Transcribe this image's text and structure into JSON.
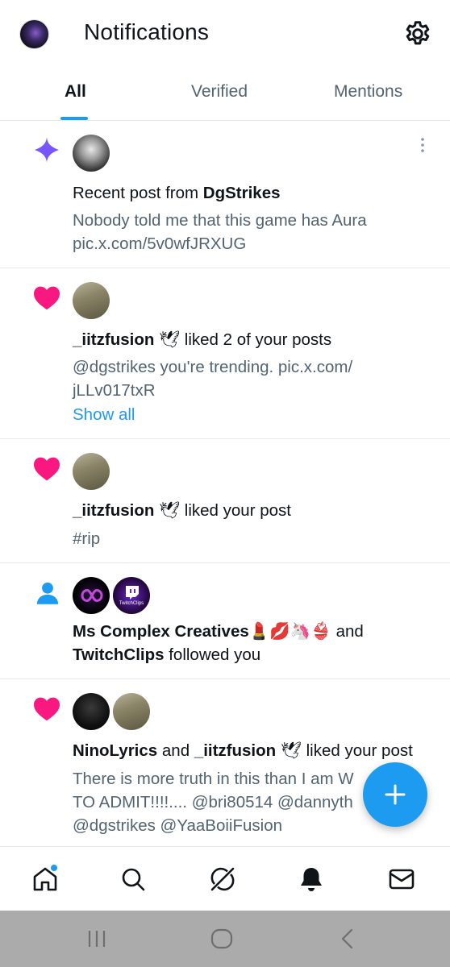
{
  "header": {
    "title": "Notifications"
  },
  "tabs": [
    {
      "label": "All",
      "active": true
    },
    {
      "label": "Verified",
      "active": false
    },
    {
      "label": "Mentions",
      "active": false
    }
  ],
  "notifications": [
    {
      "type": "recent-post",
      "icon": "sparkle-icon",
      "prefix": "Recent post from ",
      "user": "DgStrikes",
      "body_line1": "Nobody told me that this game has Aura",
      "body_line2": "pic.x.com/5v0wfJRXUG"
    },
    {
      "type": "like",
      "icon": "heart-icon",
      "user": "_iitzfusion",
      "action": "liked 2 of your posts",
      "body_line1": "@dgstrikes you're trending. pic.x.com/",
      "body_line2": "jLLv017txR",
      "show_all": "Show all"
    },
    {
      "type": "like",
      "icon": "heart-icon",
      "user": "_iitzfusion",
      "action": "liked your post",
      "body_line1": "#rip"
    },
    {
      "type": "follow",
      "icon": "person-icon",
      "user1": "Ms Complex Creatives",
      "user1_emoji": "💄💋🦄👙",
      "joiner": "and",
      "user2": "TwitchClips",
      "action": "followed you",
      "badge_text": "TwitchClips"
    },
    {
      "type": "like",
      "icon": "heart-icon",
      "user1": "NinoLyrics",
      "joiner": "and",
      "user2": "_iitzfusion",
      "action": "liked your post",
      "body_line1": "There is more truth in this than I am W",
      "body_line2": "TO ADMIT!!!!.... @bri80514 @dannyth",
      "body_line3": "@dgstrikes @YaaBoiiFusion"
    }
  ],
  "colors": {
    "accent": "#1d9bf0",
    "like": "#f91880",
    "sparkle": "#7856ff",
    "secondary_text": "#536471"
  },
  "bottom_nav": [
    "home-icon",
    "search-icon",
    "grok-icon",
    "notifications-bell-icon",
    "messages-icon"
  ],
  "system_nav": [
    "recent-apps-icon",
    "home-circle-icon",
    "back-icon"
  ]
}
